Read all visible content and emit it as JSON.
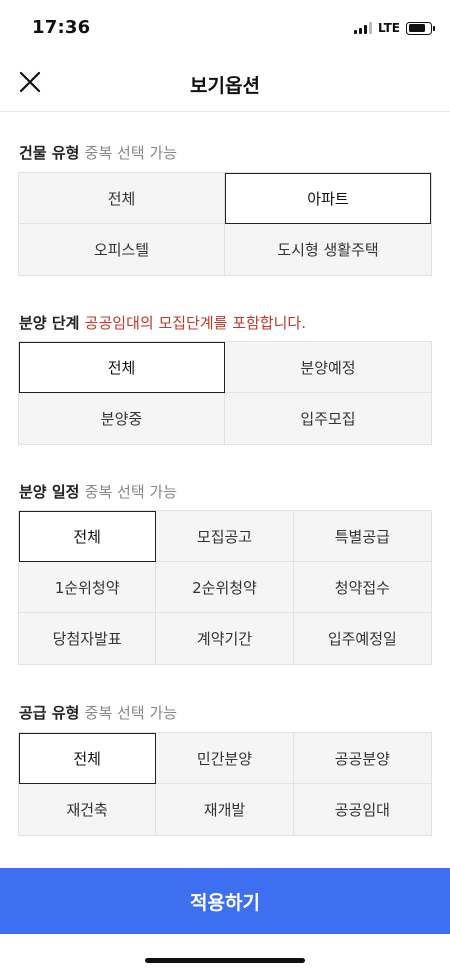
{
  "status": {
    "time": "17:36",
    "network": "LTE"
  },
  "header": {
    "title": "보기옵션",
    "close_icon": "close-icon"
  },
  "sections": {
    "building_type": {
      "title": "건물 유형",
      "note": "중복 선택 가능",
      "options": [
        "전체",
        "아파트",
        "오피스텔",
        "도시형 생활주택"
      ],
      "selected": [
        "아파트"
      ]
    },
    "sale_stage": {
      "title": "분양 단계",
      "note": "공공임대의 모집단계를 포함합니다.",
      "note_color": "#c0392b",
      "options": [
        "전체",
        "분양예정",
        "분양중",
        "입주모집"
      ],
      "selected": [
        "전체"
      ]
    },
    "sale_schedule": {
      "title": "분양 일정",
      "note": "중복 선택 가능",
      "options": [
        "전체",
        "모집공고",
        "특별공급",
        "1순위청약",
        "2순위청약",
        "청약접수",
        "당첨자발표",
        "계약기간",
        "입주예정일"
      ],
      "selected": [
        "전체"
      ]
    },
    "supply_type": {
      "title": "공급 유형",
      "note": "중복 선택 가능",
      "options": [
        "전체",
        "민간분양",
        "공공분양",
        "재건축",
        "재개발",
        "공공임대"
      ],
      "selected": [
        "전체"
      ]
    }
  },
  "apply_button": {
    "label": "적용하기",
    "color": "#3e6ff0"
  }
}
